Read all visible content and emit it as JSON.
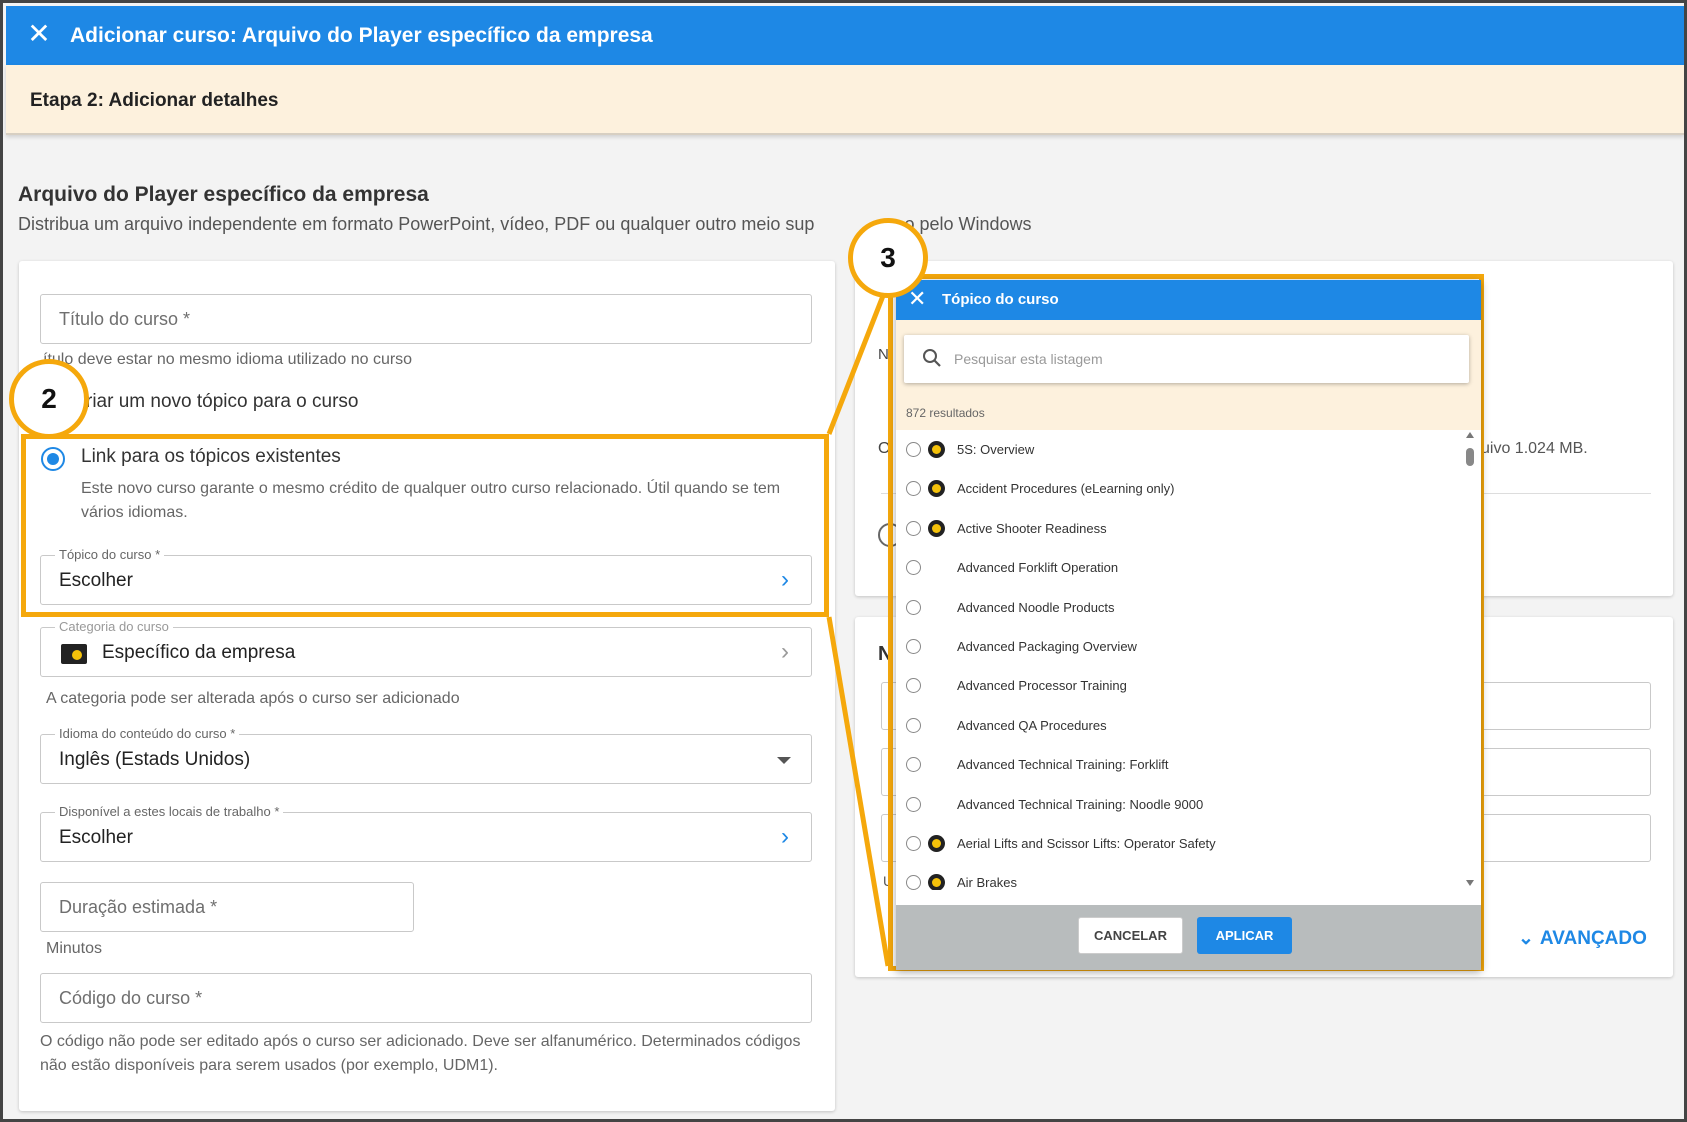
{
  "header": {
    "title": "Adicionar curso: Arquivo do Player específico da empresa",
    "close_icon": "close-icon"
  },
  "step": {
    "label": "Etapa 2: Adicionar detalhes"
  },
  "section": {
    "title": "Arquivo do Player específico da empresa",
    "description": "Distribua um arquivo independente em formato PowerPoint, vídeo, PDF ou qualquer outro meio sup",
    "description_tail": "o pelo Windows"
  },
  "form": {
    "course_title_placeholder": "Título do curso *",
    "course_title_helper": "ítulo deve estar no mesmo idioma utilizado no curso",
    "new_topic_option": "riar um novo tópico para o curso",
    "link_topic_option": "Link para os tópicos existentes",
    "link_topic_desc": "Este novo curso garante o mesmo crédito de qualquer outro curso relacionado. Útil quando se tem vários idiomas.",
    "topic_label": "Tópico do curso *",
    "topic_value": "Escolher",
    "category_label": "Categoria do curso",
    "category_value": "Específico da empresa",
    "category_helper": "A categoria pode ser alterada após o curso ser adicionado",
    "language_label": "Idioma do conteúdo do curso *",
    "language_value": "Inglês (Estads Unidos)",
    "locations_label": "Disponível a estes locais de trabalho *",
    "locations_value": "Escolher",
    "duration_placeholder": "Duração estimada *",
    "duration_helper": "Minutos",
    "code_placeholder": "Código do curso *",
    "code_helper": "O código não pode ser editado após o curso ser adicionado. Deve ser alfanumérico. Determinados códigos não estão disponíveis para serem usados (por exemplo, UDM1)."
  },
  "right_panel": {
    "n_label": "N",
    "o_label": "O",
    "file_limit_text": "uivo 1.024 MB.",
    "section_heading_fragment": "N",
    "u_label": "U",
    "advanced_label": "AVANÇADO"
  },
  "callouts": {
    "two": "2",
    "three": "3"
  },
  "modal": {
    "title": "Tópico do curso",
    "search_placeholder": "Pesquisar esta listagem",
    "results": "872 resultados",
    "items": [
      {
        "label": "5S: Overview",
        "badge": true
      },
      {
        "label": "Accident Procedures (eLearning only)",
        "badge": true
      },
      {
        "label": "Active Shooter Readiness",
        "badge": true
      },
      {
        "label": "Advanced Forklift Operation",
        "badge": false
      },
      {
        "label": "Advanced Noodle Products",
        "badge": false
      },
      {
        "label": "Advanced Packaging Overview",
        "badge": false
      },
      {
        "label": "Advanced Processor Training",
        "badge": false
      },
      {
        "label": "Advanced QA Procedures",
        "badge": false
      },
      {
        "label": "Advanced Technical Training: Forklift",
        "badge": false
      },
      {
        "label": "Advanced Technical Training: Noodle 9000",
        "badge": false
      },
      {
        "label": "Aerial Lifts and Scissor Lifts: Operator Safety",
        "badge": true
      },
      {
        "label": "Air Brakes",
        "badge": true
      }
    ],
    "cancel_label": "CANCELAR",
    "apply_label": "APLICAR"
  },
  "colors": {
    "primary": "#1e88e5",
    "highlight": "#f5a80c",
    "step_bg": "#fdf1dd",
    "badge": "#f5c20a"
  }
}
